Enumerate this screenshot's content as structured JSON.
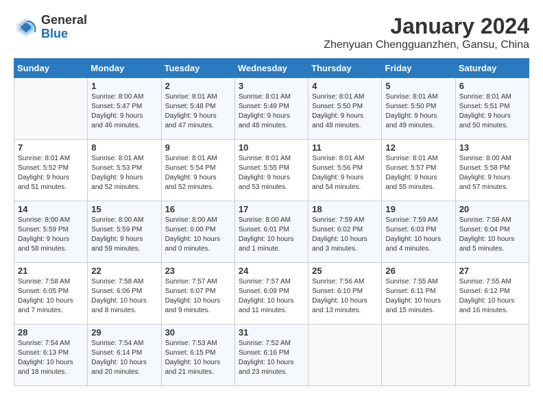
{
  "header": {
    "logo_general": "General",
    "logo_blue": "Blue",
    "title": "January 2024",
    "subtitle": "Zhenyuan Chengguanzhen, Gansu, China"
  },
  "weekdays": [
    "Sunday",
    "Monday",
    "Tuesday",
    "Wednesday",
    "Thursday",
    "Friday",
    "Saturday"
  ],
  "weeks": [
    [
      {
        "day": "",
        "sunrise": "",
        "sunset": "",
        "daylight": ""
      },
      {
        "day": "1",
        "sunrise": "Sunrise: 8:00 AM",
        "sunset": "Sunset: 5:47 PM",
        "daylight": "Daylight: 9 hours and 46 minutes."
      },
      {
        "day": "2",
        "sunrise": "Sunrise: 8:01 AM",
        "sunset": "Sunset: 5:48 PM",
        "daylight": "Daylight: 9 hours and 47 minutes."
      },
      {
        "day": "3",
        "sunrise": "Sunrise: 8:01 AM",
        "sunset": "Sunset: 5:49 PM",
        "daylight": "Daylight: 9 hours and 48 minutes."
      },
      {
        "day": "4",
        "sunrise": "Sunrise: 8:01 AM",
        "sunset": "Sunset: 5:50 PM",
        "daylight": "Daylight: 9 hours and 48 minutes."
      },
      {
        "day": "5",
        "sunrise": "Sunrise: 8:01 AM",
        "sunset": "Sunset: 5:50 PM",
        "daylight": "Daylight: 9 hours and 49 minutes."
      },
      {
        "day": "6",
        "sunrise": "Sunrise: 8:01 AM",
        "sunset": "Sunset: 5:51 PM",
        "daylight": "Daylight: 9 hours and 50 minutes."
      }
    ],
    [
      {
        "day": "7",
        "sunrise": "Sunrise: 8:01 AM",
        "sunset": "Sunset: 5:52 PM",
        "daylight": "Daylight: 9 hours and 51 minutes."
      },
      {
        "day": "8",
        "sunrise": "Sunrise: 8:01 AM",
        "sunset": "Sunset: 5:53 PM",
        "daylight": "Daylight: 9 hours and 52 minutes."
      },
      {
        "day": "9",
        "sunrise": "Sunrise: 8:01 AM",
        "sunset": "Sunset: 5:54 PM",
        "daylight": "Daylight: 9 hours and 52 minutes."
      },
      {
        "day": "10",
        "sunrise": "Sunrise: 8:01 AM",
        "sunset": "Sunset: 5:55 PM",
        "daylight": "Daylight: 9 hours and 53 minutes."
      },
      {
        "day": "11",
        "sunrise": "Sunrise: 8:01 AM",
        "sunset": "Sunset: 5:56 PM",
        "daylight": "Daylight: 9 hours and 54 minutes."
      },
      {
        "day": "12",
        "sunrise": "Sunrise: 8:01 AM",
        "sunset": "Sunset: 5:57 PM",
        "daylight": "Daylight: 9 hours and 55 minutes."
      },
      {
        "day": "13",
        "sunrise": "Sunrise: 8:00 AM",
        "sunset": "Sunset: 5:58 PM",
        "daylight": "Daylight: 9 hours and 57 minutes."
      }
    ],
    [
      {
        "day": "14",
        "sunrise": "Sunrise: 8:00 AM",
        "sunset": "Sunset: 5:59 PM",
        "daylight": "Daylight: 9 hours and 58 minutes."
      },
      {
        "day": "15",
        "sunrise": "Sunrise: 8:00 AM",
        "sunset": "Sunset: 5:59 PM",
        "daylight": "Daylight: 9 hours and 59 minutes."
      },
      {
        "day": "16",
        "sunrise": "Sunrise: 8:00 AM",
        "sunset": "Sunset: 6:00 PM",
        "daylight": "Daylight: 10 hours and 0 minutes."
      },
      {
        "day": "17",
        "sunrise": "Sunrise: 8:00 AM",
        "sunset": "Sunset: 6:01 PM",
        "daylight": "Daylight: 10 hours and 1 minute."
      },
      {
        "day": "18",
        "sunrise": "Sunrise: 7:59 AM",
        "sunset": "Sunset: 6:02 PM",
        "daylight": "Daylight: 10 hours and 3 minutes."
      },
      {
        "day": "19",
        "sunrise": "Sunrise: 7:59 AM",
        "sunset": "Sunset: 6:03 PM",
        "daylight": "Daylight: 10 hours and 4 minutes."
      },
      {
        "day": "20",
        "sunrise": "Sunrise: 7:58 AM",
        "sunset": "Sunset: 6:04 PM",
        "daylight": "Daylight: 10 hours and 5 minutes."
      }
    ],
    [
      {
        "day": "21",
        "sunrise": "Sunrise: 7:58 AM",
        "sunset": "Sunset: 6:05 PM",
        "daylight": "Daylight: 10 hours and 7 minutes."
      },
      {
        "day": "22",
        "sunrise": "Sunrise: 7:58 AM",
        "sunset": "Sunset: 6:06 PM",
        "daylight": "Daylight: 10 hours and 8 minutes."
      },
      {
        "day": "23",
        "sunrise": "Sunrise: 7:57 AM",
        "sunset": "Sunset: 6:07 PM",
        "daylight": "Daylight: 10 hours and 9 minutes."
      },
      {
        "day": "24",
        "sunrise": "Sunrise: 7:57 AM",
        "sunset": "Sunset: 6:09 PM",
        "daylight": "Daylight: 10 hours and 11 minutes."
      },
      {
        "day": "25",
        "sunrise": "Sunrise: 7:56 AM",
        "sunset": "Sunset: 6:10 PM",
        "daylight": "Daylight: 10 hours and 13 minutes."
      },
      {
        "day": "26",
        "sunrise": "Sunrise: 7:55 AM",
        "sunset": "Sunset: 6:11 PM",
        "daylight": "Daylight: 10 hours and 15 minutes."
      },
      {
        "day": "27",
        "sunrise": "Sunrise: 7:55 AM",
        "sunset": "Sunset: 6:12 PM",
        "daylight": "Daylight: 10 hours and 16 minutes."
      }
    ],
    [
      {
        "day": "28",
        "sunrise": "Sunrise: 7:54 AM",
        "sunset": "Sunset: 6:13 PM",
        "daylight": "Daylight: 10 hours and 18 minutes."
      },
      {
        "day": "29",
        "sunrise": "Sunrise: 7:54 AM",
        "sunset": "Sunset: 6:14 PM",
        "daylight": "Daylight: 10 hours and 20 minutes."
      },
      {
        "day": "30",
        "sunrise": "Sunrise: 7:53 AM",
        "sunset": "Sunset: 6:15 PM",
        "daylight": "Daylight: 10 hours and 21 minutes."
      },
      {
        "day": "31",
        "sunrise": "Sunrise: 7:52 AM",
        "sunset": "Sunset: 6:16 PM",
        "daylight": "Daylight: 10 hours and 23 minutes."
      },
      {
        "day": "",
        "sunrise": "",
        "sunset": "",
        "daylight": ""
      },
      {
        "day": "",
        "sunrise": "",
        "sunset": "",
        "daylight": ""
      },
      {
        "day": "",
        "sunrise": "",
        "sunset": "",
        "daylight": ""
      }
    ]
  ]
}
